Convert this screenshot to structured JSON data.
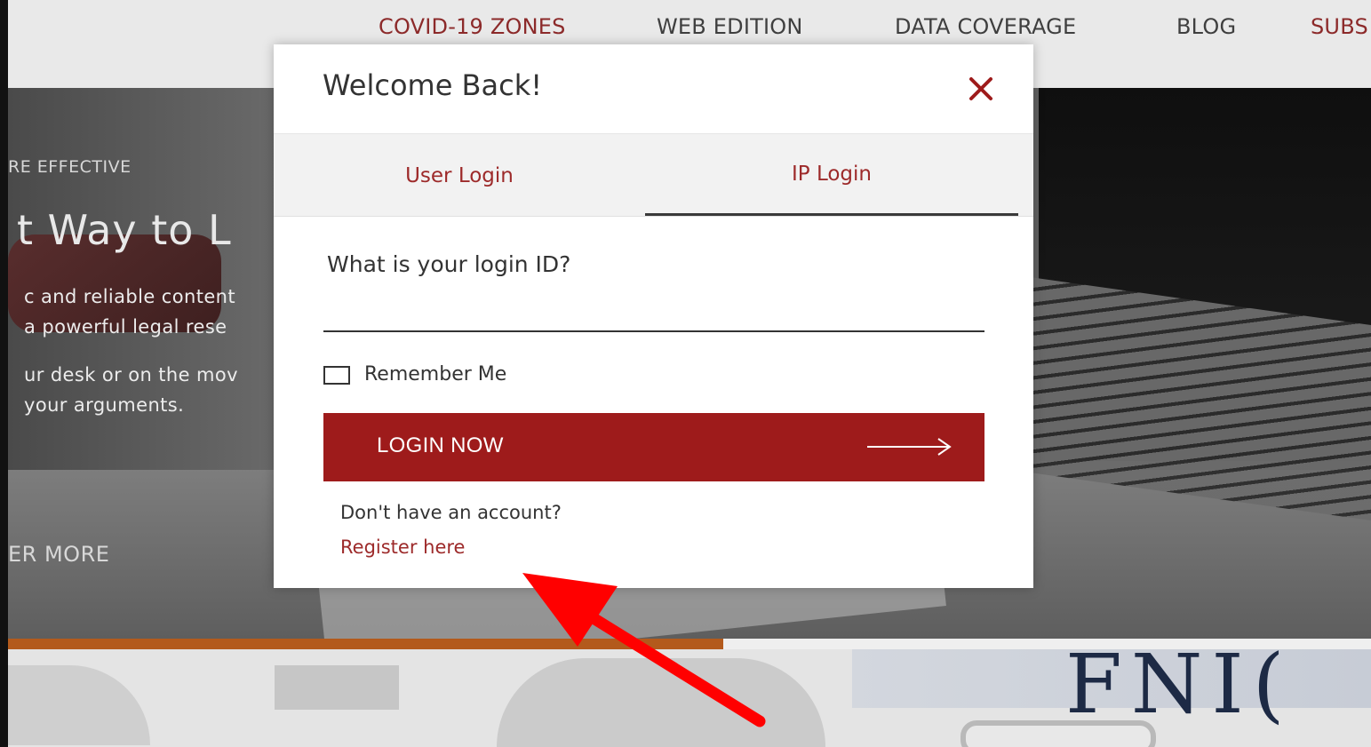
{
  "nav": {
    "items": [
      {
        "label": "COVID-19 ZONES",
        "color": "#8c2a2a"
      },
      {
        "label": "WEB EDITION",
        "color": "#3f3f3f"
      },
      {
        "label": "DATA COVERAGE",
        "color": "#3f3f3f"
      },
      {
        "label": "BLOG",
        "color": "#3f3f3f"
      },
      {
        "label": "SUBS",
        "color": "#8c2a2a"
      }
    ]
  },
  "hero": {
    "kicker": "RE EFFECTIVE",
    "title": "t Way to L",
    "lines": [
      "c and reliable content",
      "a powerful legal rese",
      "ur desk or on the mov",
      "your arguments."
    ],
    "cta": "ER MORE"
  },
  "lower": {
    "banner_text": "FNI("
  },
  "modal": {
    "title": "Welcome Back!",
    "close_icon": "close-icon",
    "tabs": [
      {
        "label": "User Login",
        "active": false
      },
      {
        "label": "IP Login",
        "active": true
      }
    ],
    "field_label": "What is your login ID?",
    "login_id_value": "",
    "remember_label": "Remember Me",
    "remember_checked": false,
    "login_button_label": "LOGIN NOW",
    "login_button_icon": "arrow-right-icon",
    "no_account_text": "Don't have an account?",
    "register_link": "Register here"
  },
  "colors": {
    "accent": "#9e1b1b",
    "link": "#9d2a2a",
    "annotation": "#ff0000"
  }
}
